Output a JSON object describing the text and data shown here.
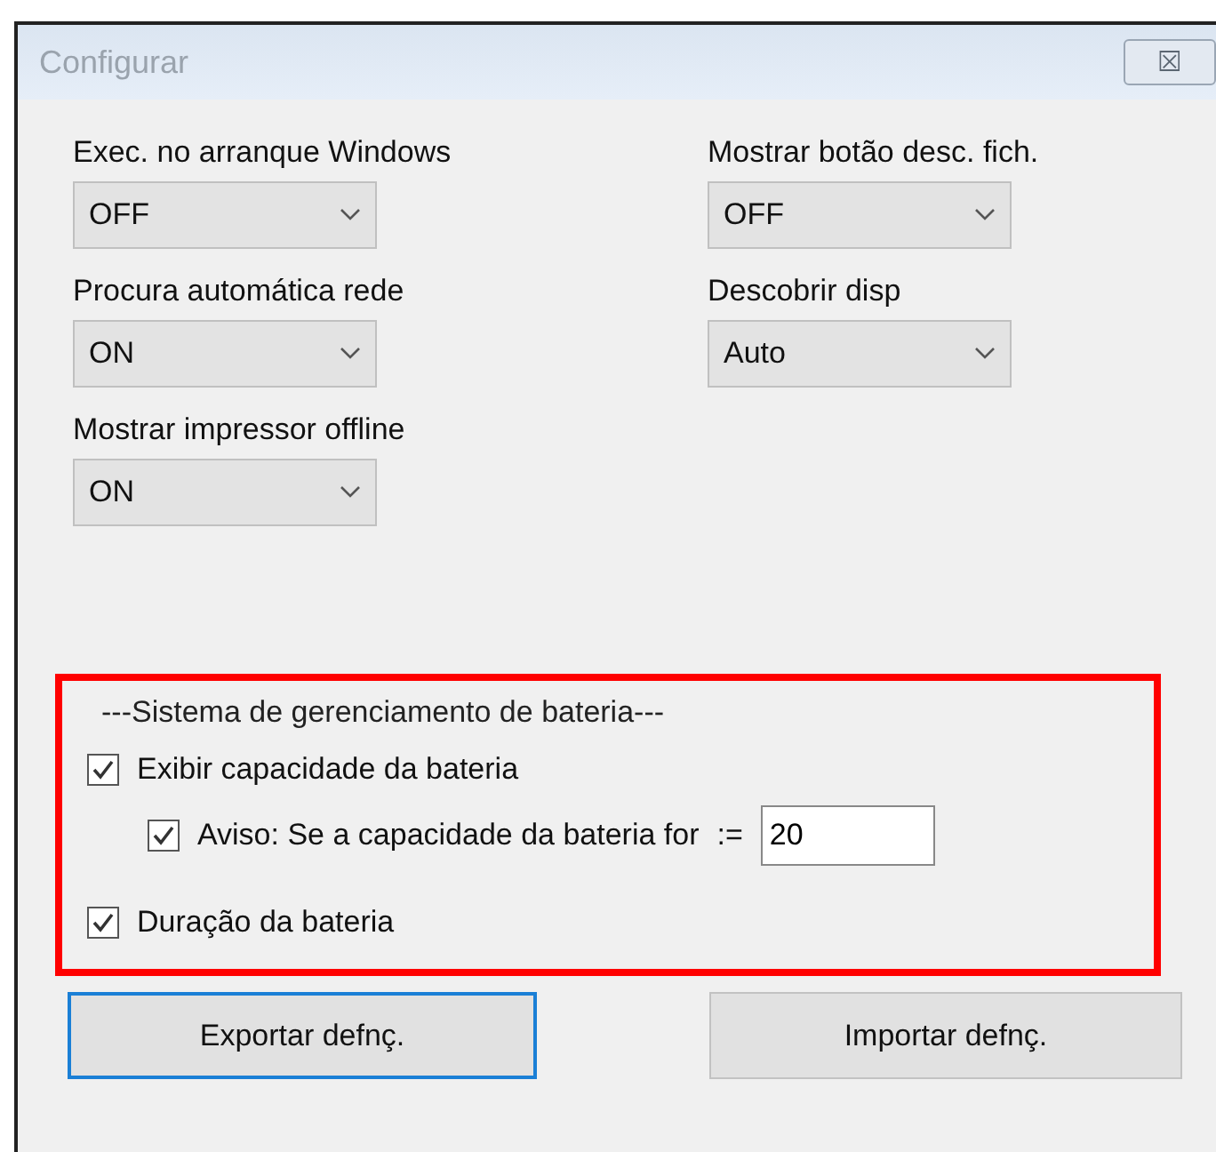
{
  "window": {
    "title": "Configurar",
    "close": "⮽"
  },
  "settings": [
    {
      "label": "Exec. no arranque Windows",
      "value": "OFF"
    },
    {
      "label": "Mostrar botão desc. fich.",
      "value": "OFF"
    },
    {
      "label": "Procura automática rede",
      "value": "ON"
    },
    {
      "label": "Descobrir disp",
      "value": "Auto"
    },
    {
      "label": "Mostrar impressor offline",
      "value": "ON"
    }
  ],
  "battery": {
    "highlighted": true,
    "heading": "---Sistema de gerenciamento de bateria---",
    "options": [
      {
        "label": "Exibir capacidade da bateria",
        "checked": true,
        "children": [
          {
            "label": "Aviso: Se a capacidade da bateria for",
            "operator": ":=",
            "value": "20",
            "checked": true
          }
        ]
      },
      {
        "label": "Duração da bateria",
        "checked": true
      }
    ]
  },
  "buttons": [
    {
      "label": "Exportar defnç.",
      "focused": true
    },
    {
      "label": "Importar defnç.",
      "focused": false
    }
  ]
}
